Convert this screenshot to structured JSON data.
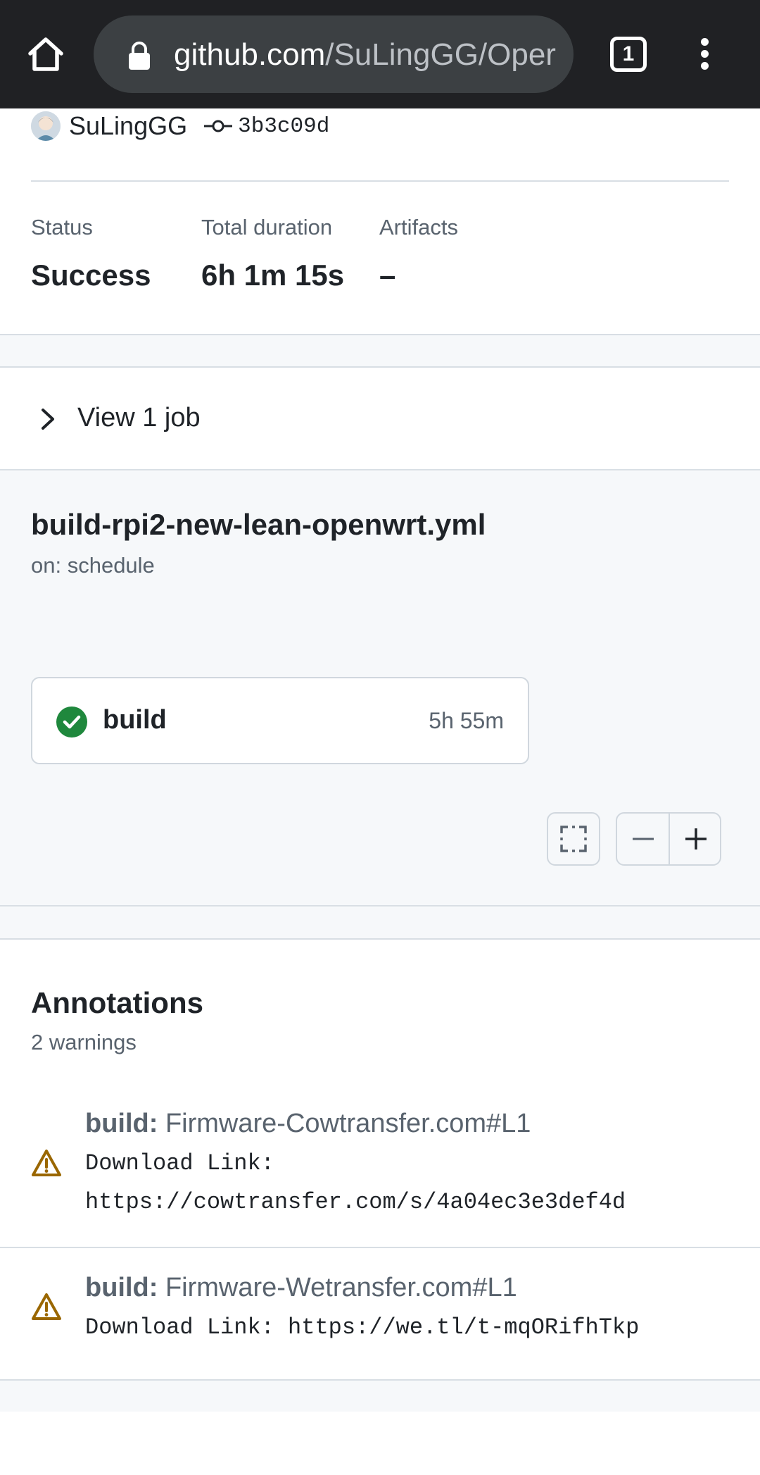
{
  "browser": {
    "url_domain": "github.com",
    "url_path": "/SuLingGG/Oper",
    "tab_count": "1"
  },
  "run": {
    "actor": "SuLingGG",
    "commit_sha": "3b3c09d"
  },
  "stats": {
    "status_label": "Status",
    "status_value": "Success",
    "duration_label": "Total duration",
    "duration_value": "6h 1m 15s",
    "artifacts_label": "Artifacts",
    "artifacts_value": "–"
  },
  "jobs_toggle": {
    "label": "View 1 job"
  },
  "workflow": {
    "name": "build-rpi2-new-lean-openwrt.yml",
    "trigger": "on: schedule",
    "job": {
      "name": "build",
      "duration": "5h 55m",
      "status": "success"
    }
  },
  "annotations": {
    "title": "Annotations",
    "summary": "2 warnings",
    "items": [
      {
        "job": "build:",
        "title": "Firmware-Cowtransfer.com#L1",
        "body": "Download Link:\nhttps://cowtransfer.com/s/4a04ec3e3def4d"
      },
      {
        "job": "build:",
        "title": "Firmware-Wetransfer.com#L1",
        "body": "Download Link: https://we.tl/t-mqORifhTkp"
      }
    ]
  },
  "colors": {
    "success": "#1f883d",
    "warning": "#9a6700",
    "browser_bar": "#202124"
  },
  "icons": {
    "home": "home-icon",
    "lock": "lock-icon",
    "tabs": "tab-switcher-icon",
    "menu": "kebab-menu-icon",
    "commit": "git-commit-icon",
    "chevron": "chevron-right-icon",
    "check": "check-circle-icon",
    "fullscreen": "fullscreen-icon",
    "zoom_out": "minus-icon",
    "zoom_in": "plus-icon",
    "warning": "alert-triangle-icon"
  }
}
